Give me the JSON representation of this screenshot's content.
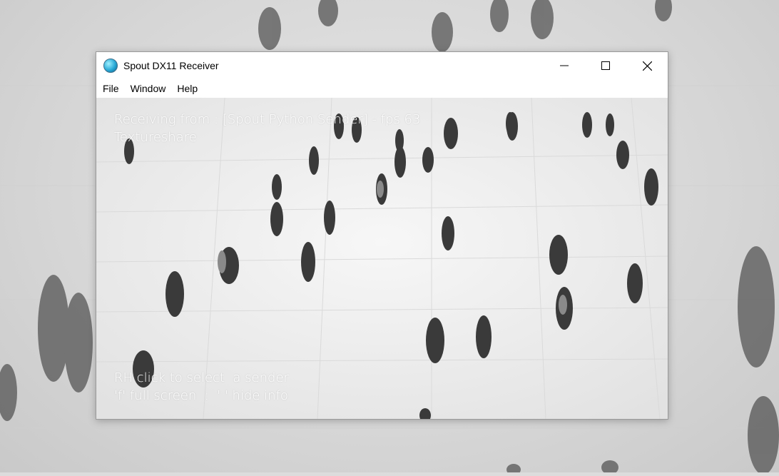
{
  "window": {
    "title": "Spout DX11 Receiver",
    "icon": "spout-app-icon"
  },
  "menu": [
    "File",
    "Window",
    "Help"
  ],
  "overlay": {
    "line1": "Receiving from : [Spout Python Sender] - fps 63",
    "line2": "Textureshare",
    "hint1": "RH click to select  a sender",
    "hint2": "'f' full screen  :  ' ' hide info"
  }
}
